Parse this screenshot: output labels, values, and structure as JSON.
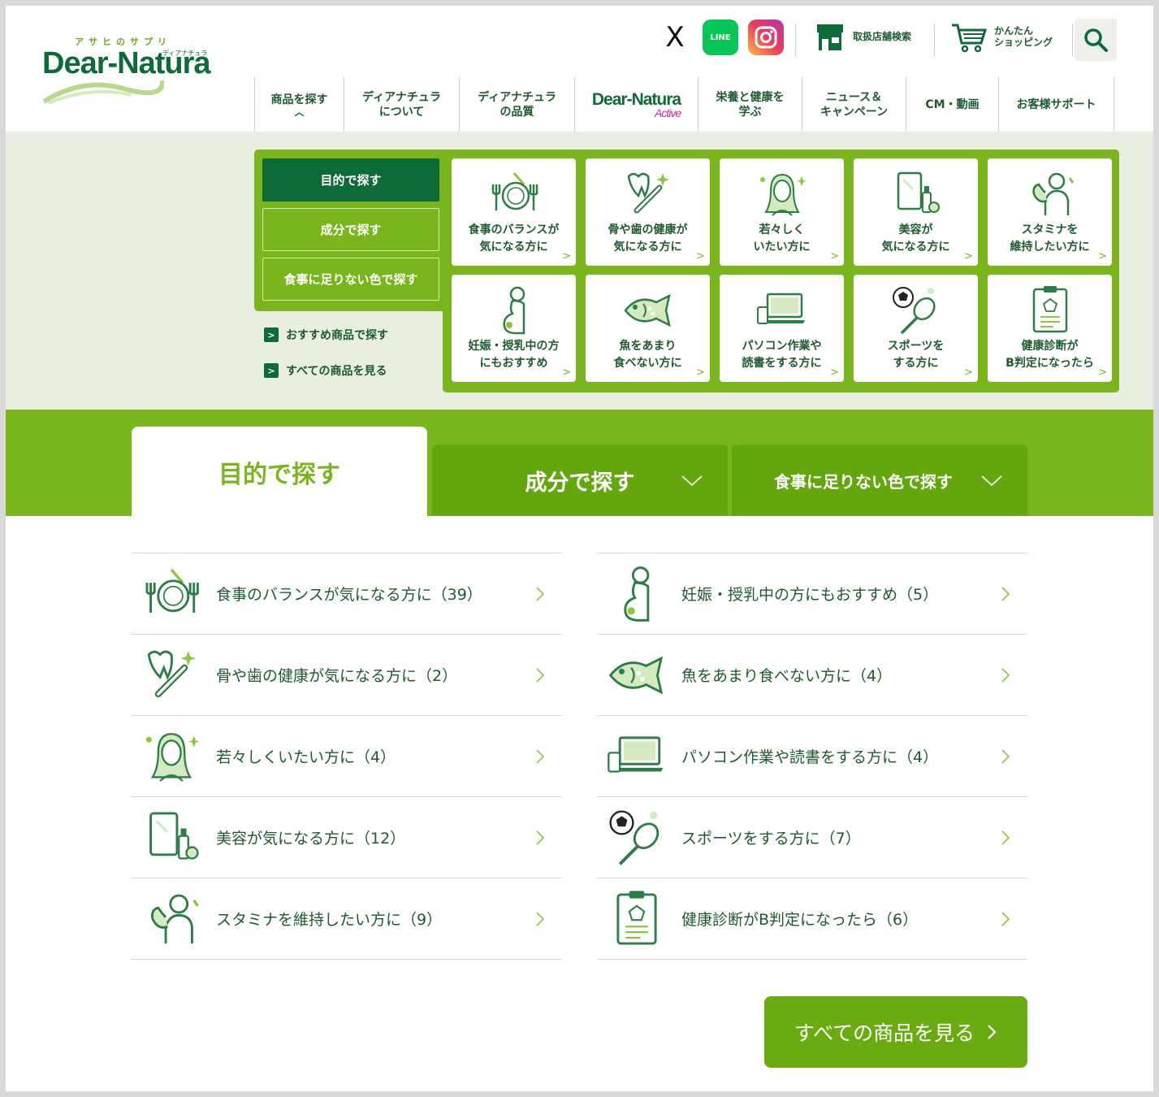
{
  "header": {
    "logo_ruby": "アサヒのサプリ",
    "logo_brand": "Dear-Natura",
    "logo_ruby_small": "ディアナチュラ",
    "social": [
      {
        "name": "x-icon",
        "label": "X"
      },
      {
        "name": "line-icon",
        "label": "LINE"
      },
      {
        "name": "instagram-icon",
        "label": ""
      }
    ],
    "store_search": "取扱店舗検索",
    "shopping_line1": "かんたん",
    "shopping_line2": "ショッピング"
  },
  "gnav": [
    {
      "label": "商品を探す",
      "active": true
    },
    {
      "label": "ディアナチュラ\nについて"
    },
    {
      "label": "ディアナチュラ\nの品質"
    },
    {
      "label": "Dear-Natura Active"
    },
    {
      "label": "栄養と健康を\n学ぶ"
    },
    {
      "label": "ニュース＆\nキャンペーン"
    },
    {
      "label": "CM・動画"
    },
    {
      "label": "お客様サポート"
    }
  ],
  "gnav_active_logo": {
    "main": "Dear-Natura",
    "sub": "Active"
  },
  "mega": {
    "side_buttons": [
      "目的で探す",
      "成分で探す",
      "食事に足りない色で探す"
    ],
    "links": [
      "おすすめ商品で探す",
      "すべての商品を見る"
    ],
    "cards": [
      {
        "icon": "plate-icon",
        "l1": "食事のバランスが",
        "l2": "気になる方に"
      },
      {
        "icon": "bone-tooth-icon",
        "l1": "骨や歯の健康が",
        "l2": "気になる方に"
      },
      {
        "icon": "young-woman-icon",
        "l1": "若々しく",
        "l2": "いたい方に"
      },
      {
        "icon": "mirror-cosmetics-icon",
        "l1": "美容が",
        "l2": "気になる方に"
      },
      {
        "icon": "muscle-man-icon",
        "l1": "スタミナを",
        "l2": "維持したい方に"
      },
      {
        "icon": "pregnant-woman-icon",
        "l1": "妊娠・授乳中の方",
        "l2": "にもおすすめ"
      },
      {
        "icon": "fish-icon",
        "l1": "魚をあまり",
        "l2": "食べない方に"
      },
      {
        "icon": "laptop-icon",
        "l1": "パソコン作業や",
        "l2": "読書をする方に"
      },
      {
        "icon": "sports-icon",
        "l1": "スポーツを",
        "l2": "する方に"
      },
      {
        "icon": "clipboard-icon",
        "l1": "健康診断が",
        "l2": "B判定になったら"
      }
    ]
  },
  "tabs": [
    "目的で探す",
    "成分で探す",
    "食事に足りない色で探す"
  ],
  "list_left": [
    {
      "icon": "plate-icon",
      "text": "食事のバランスが気になる方に（39）"
    },
    {
      "icon": "bone-tooth-icon",
      "text": "骨や歯の健康が気になる方に（2）"
    },
    {
      "icon": "young-woman-icon",
      "text": "若々しくいたい方に（4）"
    },
    {
      "icon": "mirror-cosmetics-icon",
      "text": "美容が気になる方に（12）"
    },
    {
      "icon": "muscle-man-icon",
      "text": "スタミナを維持したい方に（9）"
    }
  ],
  "list_right": [
    {
      "icon": "pregnant-woman-icon",
      "text": "妊娠・授乳中の方にもおすすめ（5）"
    },
    {
      "icon": "fish-icon",
      "text": "魚をあまり食べない方に（4）"
    },
    {
      "icon": "laptop-icon",
      "text": "パソコン作業や読書をする方に（4）"
    },
    {
      "icon": "sports-icon",
      "text": "スポーツをする方に（7）"
    },
    {
      "icon": "clipboard-icon",
      "text": "健康診断がB判定になったら（6）"
    }
  ],
  "all_products": "すべての商品を見る",
  "colors": {
    "dark_green": "#0f6a3a",
    "lime": "#7bb51d",
    "bg_tint": "#e9efe0"
  }
}
